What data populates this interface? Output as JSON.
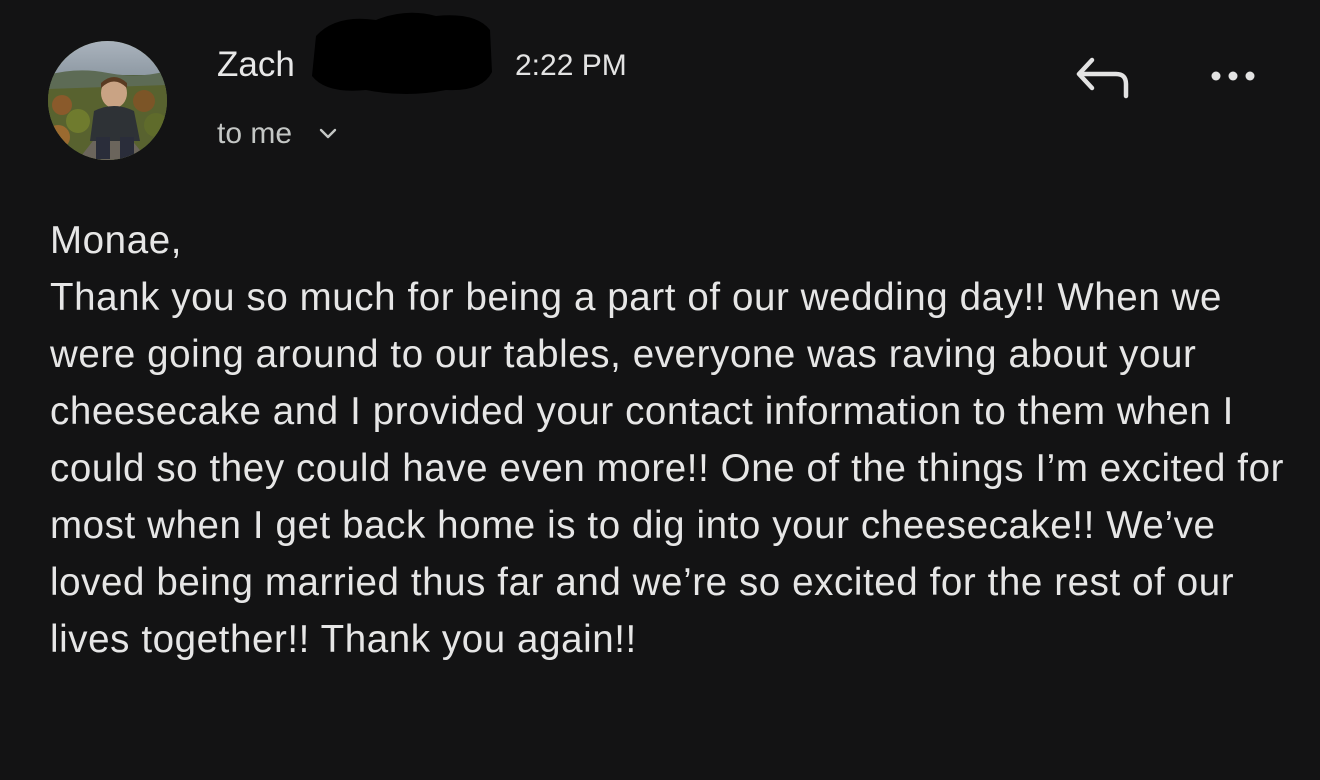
{
  "email": {
    "sender": {
      "name": "Zach",
      "avatar_icon": "profile-photo"
    },
    "time": "2:22 PM",
    "recipient_label": "to me",
    "actions": {
      "reply_icon": "reply-icon",
      "more_icon": "more-options-icon"
    },
    "body": {
      "greeting": "Monae,",
      "text": "Thank you so much for being a part of our wedding day!! When we were going around to our tables, everyone was raving about your cheesecake and I provided your contact information to them when I could so they could have even more!! One of the things I’m excited for most when I get back home is to dig into your cheesecake!! We’ve loved being married thus far and we’re so excited for the rest of our lives together!! Thank you again!!"
    }
  },
  "colors": {
    "background": "#131314",
    "text_primary": "#e6e6e6",
    "text_secondary": "#c4c7c5",
    "redaction": "#000000"
  }
}
